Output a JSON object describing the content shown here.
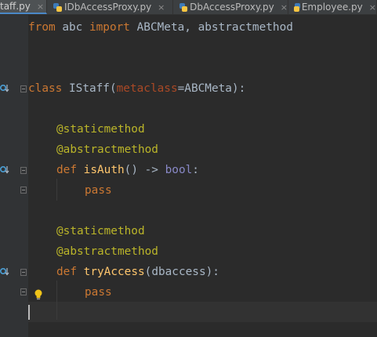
{
  "tabs": [
    {
      "label": "taff.py",
      "active": true
    },
    {
      "label": "IDbAccessProxy.py",
      "active": false
    },
    {
      "label": "DbAccessProxy.py",
      "active": false
    },
    {
      "label": "Employee.py",
      "active": false
    }
  ],
  "tab_close_glyph": "×",
  "code": {
    "line1": {
      "kw1": "from",
      "mod": " abc ",
      "kw2": "import",
      "rest": " ABCMeta, abstractmethod"
    },
    "line4": {
      "kw": "class",
      "name": " IStaff(",
      "param": "metaclass",
      "rest": "=ABCMeta):"
    },
    "line6": {
      "deco": "@staticmethod"
    },
    "line7": {
      "deco": "@abstractmethod"
    },
    "line8": {
      "kw": "def",
      "name": "isAuth",
      "rest": "() -> ",
      "builtin": "bool",
      "colon": ":"
    },
    "line9": {
      "kw": "pass"
    },
    "line11": {
      "deco": "@staticmethod"
    },
    "line12": {
      "deco": "@abstractmethod"
    },
    "line13": {
      "kw": "def",
      "name": "tryAccess",
      "rest": "(dbaccess):"
    },
    "line14": {
      "kw": "pass"
    }
  },
  "colors": {
    "keyword": "#cc7832",
    "decorator": "#bbb529",
    "function": "#ffc66d",
    "builtin": "#8888c6",
    "parameter": "#aa4926",
    "text": "#a9b7c6",
    "background": "#2b2b2b"
  },
  "gutter_icons": [
    "implemented-override-icon",
    "fold-icon",
    "lightbulb-icon"
  ]
}
